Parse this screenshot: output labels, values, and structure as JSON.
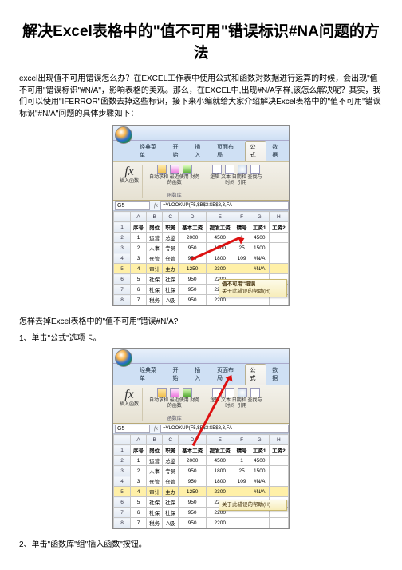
{
  "title": "解决Excel表格中的\"值不可用\"错误标识#NA问题的方法",
  "intro": "excel出现值不可用错误怎么办？在EXCEL工作表中使用公式和函数对数据进行运算的时候，会出现\"值不可用\"错误标识\"#N/A\"，影响表格的美观。那么，在EXCEL中,出现#N/A字样,该怎么解决呢？其实，我们可以使用\"IFERROR\"函数去掉这些标识，接下来小编就给大家介绍解决Excel表格中的\"值不可用\"错误标识\"#N/A\"问题的具体步骤如下：",
  "q1": "怎样去掉Excel表格中的\"值不可用\"错误#N/A?",
  "step1": "1、单击\"公式\"选项卡。",
  "step2": "2、单击\"函数库\"组\"插入函数\"按钮。",
  "ribbon": {
    "tabs": {
      "t0": "经典菜单",
      "t1": "开始",
      "t2": "插入",
      "t3": "页面布局",
      "t4": "公式",
      "t5": "数据"
    },
    "insertfn": "插入函数",
    "g1a": "自动求和",
    "g1b": "最近使用",
    "g1c": "财务",
    "g1sub": "的函数",
    "g2a": "逻辑",
    "g2b": "文本",
    "g2c": "日期和",
    "g2d": "查找与",
    "g2sub": "时间",
    "g2sub2": "引用",
    "grplabel": "函数库"
  },
  "formula": {
    "cell": "G5",
    "bar": "=VLOOKUP(F5,$B$3:$E$8,3,FA"
  },
  "headers": {
    "A": "序号",
    "B": "岗位",
    "C": "职务",
    "D": "基本工资",
    "E": "提发工资",
    "F": "精号",
    "G": "工资1",
    "H": "工资2"
  },
  "rows": [
    {
      "n": "1",
      "a": "运营",
      "b": "总监",
      "c": "2000",
      "d": "4500",
      "e": "1",
      "f": "4500",
      "g": ""
    },
    {
      "n": "2",
      "a": "人事",
      "b": "专员",
      "c": "950",
      "d": "1800",
      "e": "25",
      "f": "1500",
      "g": ""
    },
    {
      "n": "3",
      "a": "仓管",
      "b": "仓管",
      "c": "950",
      "d": "1800",
      "e": "109",
      "f": "#N/A",
      "g": ""
    },
    {
      "n": "4",
      "a": "审计",
      "b": "主办",
      "c": "1250",
      "d": "2300",
      "e": "",
      "f": "#N/A",
      "g": ""
    },
    {
      "n": "5",
      "a": "社保",
      "b": "社保",
      "c": "950",
      "d": "2200",
      "e": "",
      "f": "",
      "g": ""
    },
    {
      "n": "6",
      "a": "社保",
      "b": "社保",
      "c": "950",
      "d": "2200",
      "e": "",
      "f": "",
      "g": ""
    },
    {
      "n": "7",
      "a": "税务",
      "b": "A级",
      "c": "950",
      "d": "2200",
      "e": "",
      "f": "",
      "g": ""
    }
  ],
  "callout": {
    "title": "值不可用\"错误",
    "body": "关于此错误的帮助(H)"
  },
  "callout2": {
    "body": "关于此错误的帮助(H)"
  }
}
